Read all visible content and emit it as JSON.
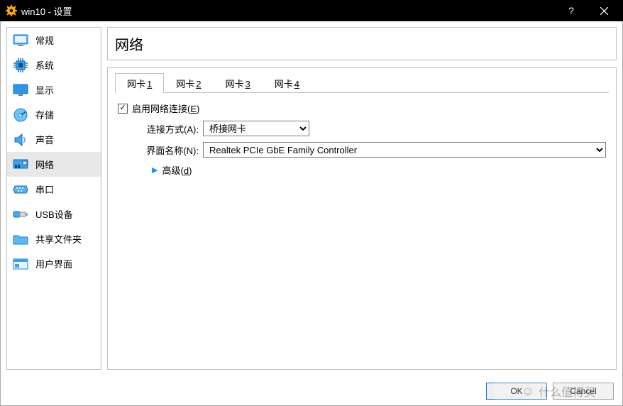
{
  "window": {
    "title": "win10 - 设置",
    "help_label": "?",
    "close_label": "✕"
  },
  "sidebar": {
    "items": [
      {
        "key": "general",
        "label": "常规",
        "icon": "monitor-icon"
      },
      {
        "key": "system",
        "label": "系统",
        "icon": "chip-icon"
      },
      {
        "key": "display",
        "label": "显示",
        "icon": "display-icon"
      },
      {
        "key": "storage",
        "label": "存储",
        "icon": "disk-icon"
      },
      {
        "key": "audio",
        "label": "声音",
        "icon": "speaker-icon"
      },
      {
        "key": "network",
        "label": "网络",
        "icon": "nic-icon"
      },
      {
        "key": "serial",
        "label": "串口",
        "icon": "serial-icon"
      },
      {
        "key": "usb",
        "label": "USB设备",
        "icon": "usb-icon"
      },
      {
        "key": "shared",
        "label": "共享文件夹",
        "icon": "folder-icon"
      },
      {
        "key": "ui",
        "label": "用户界面",
        "icon": "ui-icon"
      }
    ],
    "selected_index": 5
  },
  "page": {
    "heading": "网络",
    "tabs": {
      "prefix": "网卡",
      "hotkeys": [
        "1",
        "2",
        "3",
        "4"
      ],
      "active_index": 0
    },
    "enable": {
      "label": "启用网络连接",
      "hotkey": "E",
      "checked": true
    },
    "attach": {
      "label": "连接方式",
      "hotkey": "A",
      "value": "桥接网卡"
    },
    "ifname": {
      "label": "界面名称",
      "hotkey": "N",
      "value": "Realtek PCIe GbE Family Controller"
    },
    "advanced": {
      "label": "高级",
      "hotkey": "d"
    }
  },
  "footer": {
    "ok": "OK",
    "cancel": "Cancel"
  },
  "watermark": "什么值得买"
}
